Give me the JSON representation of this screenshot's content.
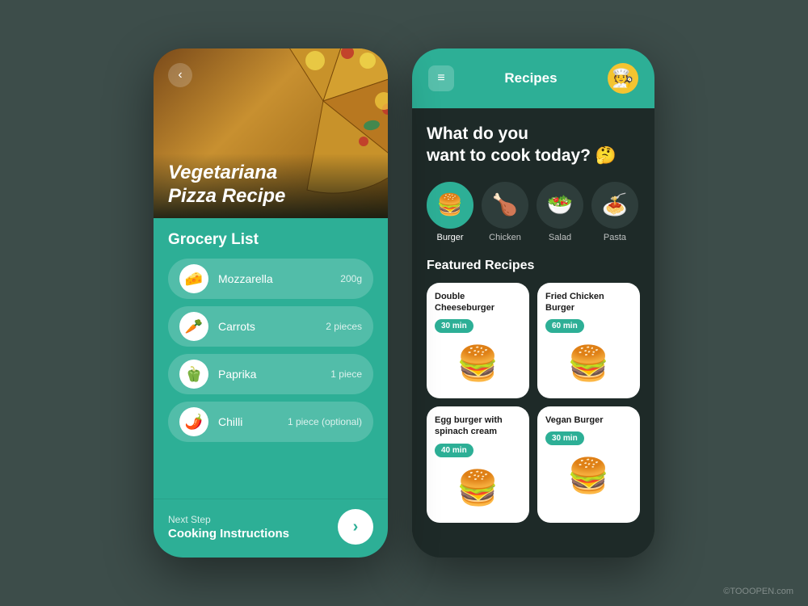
{
  "background_color": "#3d4d4a",
  "left_phone": {
    "back_button": "‹",
    "pizza_title": "Vegetariana\nPizza Recipe",
    "grocery_title": "Grocery List",
    "items": [
      {
        "icon": "🧀",
        "name": "Mozzarella",
        "qty": "200g"
      },
      {
        "icon": "🥕",
        "name": "Carrots",
        "qty": "2 pieces"
      },
      {
        "icon": "🫑",
        "name": "Paprika",
        "qty": "1 piece"
      },
      {
        "icon": "🌶️",
        "name": "Chilli",
        "qty": "1 piece (optional)"
      }
    ],
    "next_step_label": "Next Step",
    "cooking_label": "Cooking Instructions",
    "next_btn": "›"
  },
  "right_phone": {
    "header": {
      "menu_icon": "≡",
      "title": "Recipes",
      "avatar_emoji": "🧑‍🍳"
    },
    "question": "What do you\nwant to cook today? 🤔",
    "categories": [
      {
        "icon": "🍔",
        "label": "Burger",
        "active": true
      },
      {
        "icon": "🍗",
        "label": "Chicken",
        "active": false
      },
      {
        "icon": "🥗",
        "label": "Salad",
        "active": false
      },
      {
        "icon": "🍝",
        "label": "Pasta",
        "active": false
      }
    ],
    "featured_title": "Featured Recipes",
    "recipes": [
      {
        "name": "Double\nCheeseburger",
        "time": "30 min",
        "emoji": "🍔"
      },
      {
        "name": "Fried Chicken\nBurger",
        "time": "60 min",
        "emoji": "🍔"
      },
      {
        "name": "Egg burger with\nspinach cream",
        "time": "40 min",
        "emoji": "🍔"
      },
      {
        "name": "Vegan Burger",
        "time": "30 min",
        "emoji": "🍔"
      }
    ]
  },
  "watermark": "©TOOOPEN.com"
}
